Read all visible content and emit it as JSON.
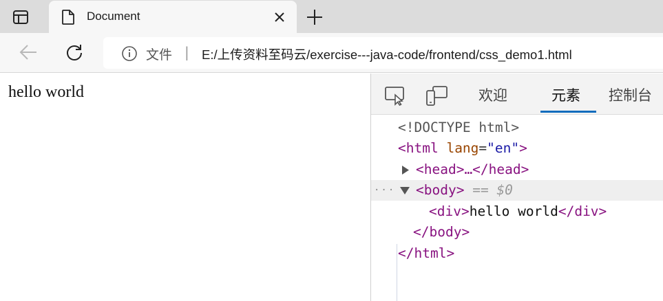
{
  "browser": {
    "tab_title": "Document",
    "address_label": "文件",
    "address_separator": "|",
    "url": "E:/上传资料至码云/exercise---java-code/frontend/css_demo1.html"
  },
  "page": {
    "content_text": "hello world"
  },
  "devtools": {
    "tabs": [
      "欢迎",
      "元素",
      "控制台"
    ],
    "active_tab": "元素",
    "dom": {
      "doctype": "<!DOCTYPE html>",
      "html_open_tag": "<html",
      "html_attr_name": "lang",
      "html_attr_value": "\"en\"",
      "html_open_close": ">",
      "head_collapsed": "<head>…</head>",
      "body_open": "<body>",
      "body_marker": "== $0",
      "div_open": "<div>",
      "div_text": "hello world",
      "div_close": "</div>",
      "body_close": "</body>",
      "html_close": "</html>",
      "ellipsis": "···"
    }
  },
  "colors": {
    "accent": "#0f6cbd",
    "tag": "#881280",
    "attr_name": "#994500",
    "attr_value": "#1a1aa6"
  },
  "icons": [
    "tab-actions-icon",
    "page-icon",
    "close-icon",
    "plus-icon",
    "back-arrow-icon",
    "refresh-icon",
    "info-icon",
    "inspect-icon",
    "device-emulation-icon"
  ]
}
